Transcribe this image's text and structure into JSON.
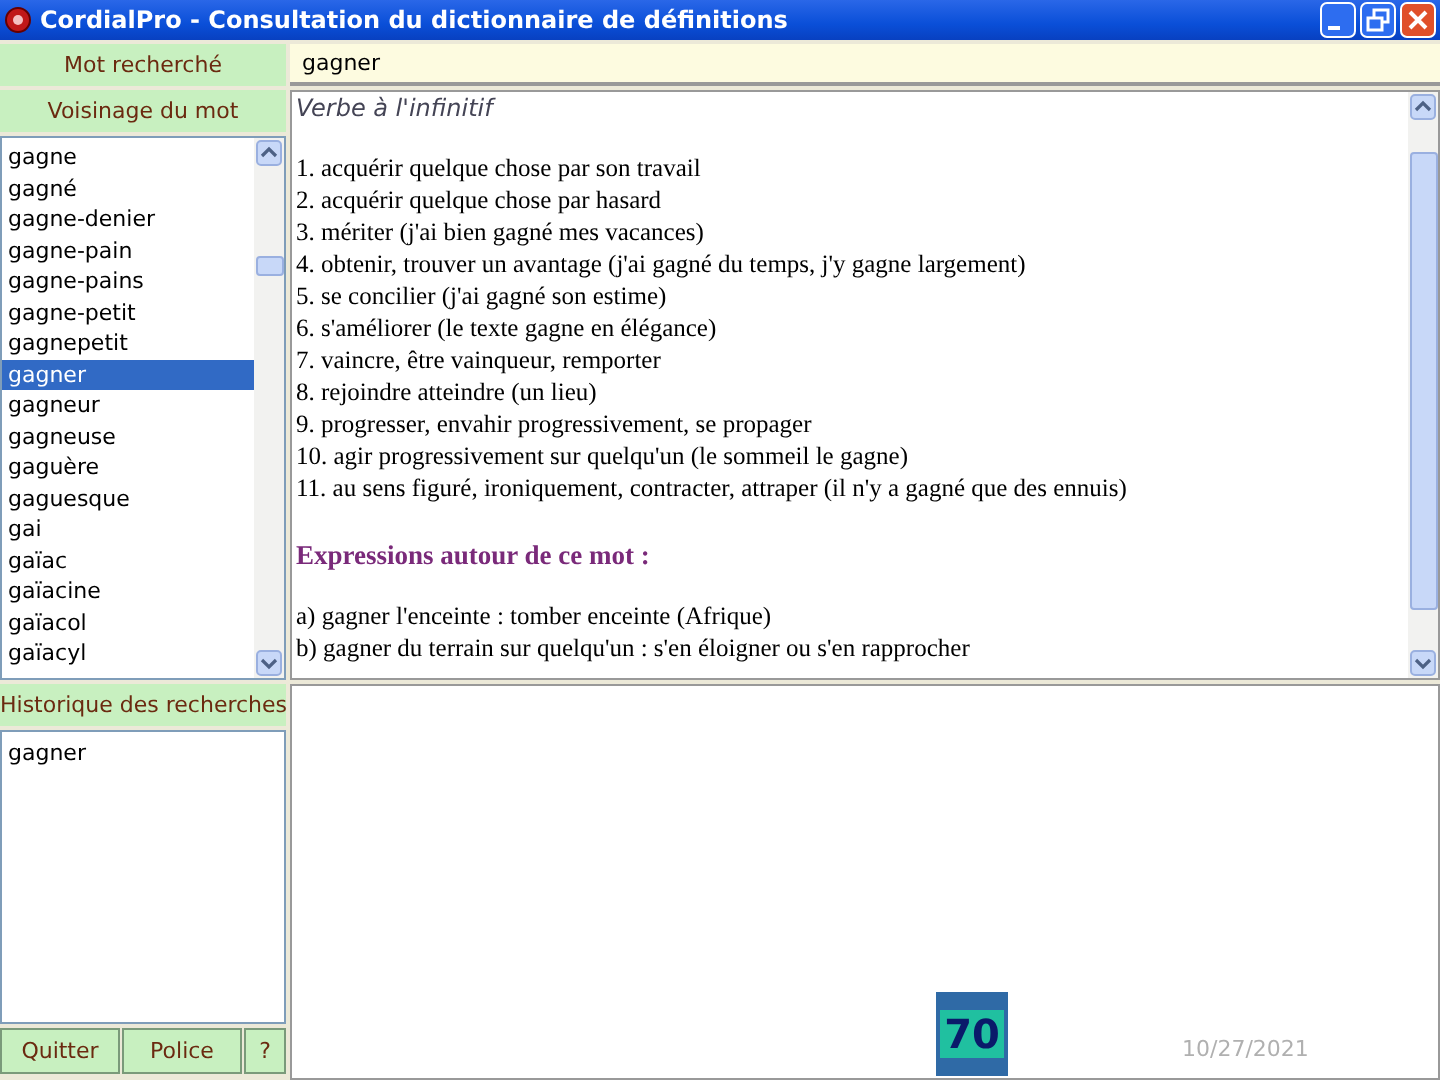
{
  "window": {
    "title": "CordialPro - Consultation du dictionnaire de définitions"
  },
  "search_label": "Mot recherché",
  "search": {
    "value": "gagner"
  },
  "neighbors_label": "Voisinage du mot",
  "neighbors": [
    {
      "label": "gagne",
      "selected": false
    },
    {
      "label": "gagné",
      "selected": false
    },
    {
      "label": "gagne-denier",
      "selected": false
    },
    {
      "label": "gagne-pain",
      "selected": false
    },
    {
      "label": "gagne-pains",
      "selected": false
    },
    {
      "label": "gagne-petit",
      "selected": false
    },
    {
      "label": "gagnepetit",
      "selected": false
    },
    {
      "label": "gagner",
      "selected": true
    },
    {
      "label": "gagneur",
      "selected": false
    },
    {
      "label": "gagneuse",
      "selected": false
    },
    {
      "label": "gaguère",
      "selected": false
    },
    {
      "label": "gaguesque",
      "selected": false
    },
    {
      "label": "gai",
      "selected": false
    },
    {
      "label": "gaïac",
      "selected": false
    },
    {
      "label": "gaïacine",
      "selected": false
    },
    {
      "label": "gaïacol",
      "selected": false
    },
    {
      "label": "gaïacyl",
      "selected": false
    }
  ],
  "definition": {
    "category": "Verbe à l'infinitif",
    "senses": [
      "1. acquérir quelque chose par son travail",
      "2. acquérir quelque chose par hasard",
      "3. mériter (j'ai bien gagné mes vacances)",
      "4. obtenir, trouver un avantage (j'ai gagné du temps, j'y gagne largement)",
      "5. se concilier (j'ai gagné son estime)",
      "6. s'améliorer (le texte gagne en élégance)",
      "7. vaincre, être vainqueur, remporter",
      "8. rejoindre atteindre (un lieu)",
      "9. progresser, envahir progressivement, se propager",
      "10. agir progressivement sur quelqu'un (le sommeil le gagne)",
      "11. au sens figuré, ironiquement, contracter, attraper (il n'y a gagné que des ennuis)"
    ],
    "expressions_heading": "Expressions autour de ce mot :",
    "expressions": [
      "a) gagner l'enceinte : tomber enceinte (Afrique)",
      "b) gagner du terrain sur quelqu'un : s'en éloigner ou s'en rapprocher"
    ]
  },
  "history_label": "Historique des recherches",
  "history": [
    "gagner"
  ],
  "buttons": [
    "Quitter",
    "Police",
    "?"
  ],
  "slide_number": "70",
  "date": "10/27/2021"
}
